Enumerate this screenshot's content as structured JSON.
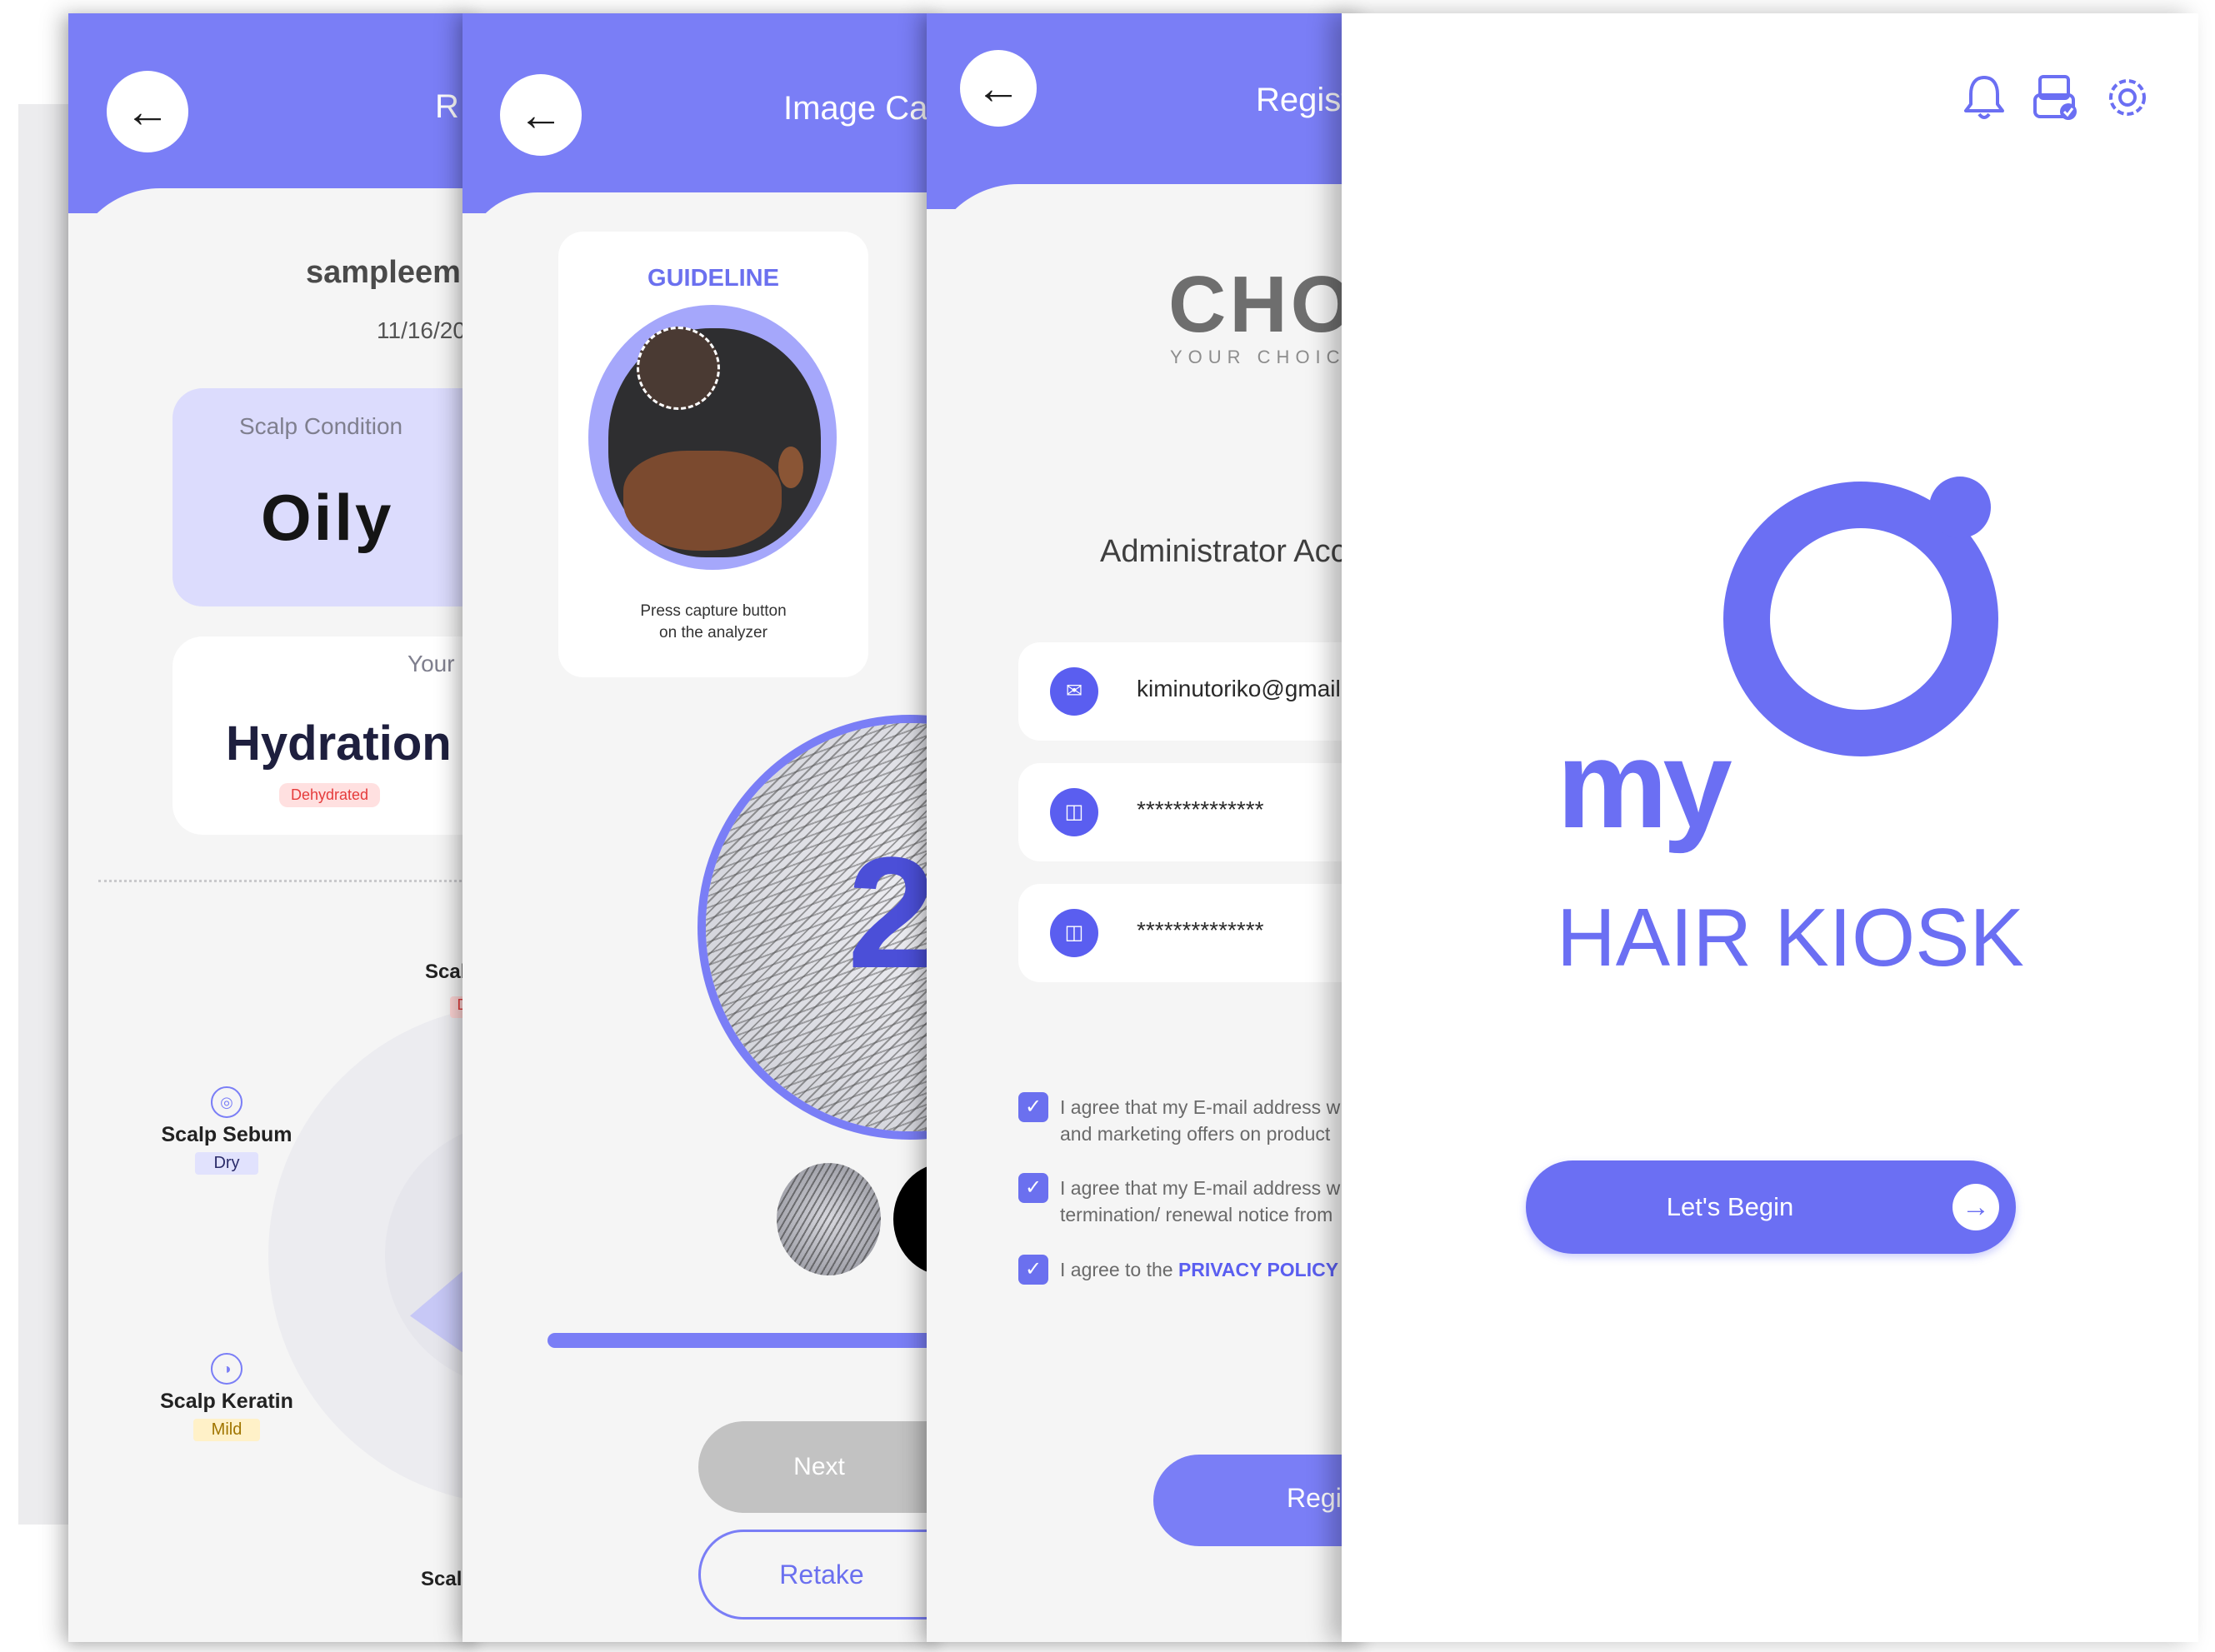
{
  "colors": {
    "accent": "#7a7ef6",
    "logo": "#6b6ff3",
    "danger": "#e53b3b"
  },
  "result_screen": {
    "header_title": "R",
    "user_name": "sampleem",
    "date": "11/16/20",
    "scalp_condition_label": "Scalp Condition",
    "scalp_condition_value": "Oily",
    "your_label": "Your",
    "hydration_title": "Hydration",
    "hydration_badge": "Dehydrated",
    "metrics": [
      {
        "name": "Scalp Sebum",
        "tag": "Dry",
        "icon": "sebum-icon"
      },
      {
        "name": "Scalp Keratin",
        "tag": "Mild",
        "icon": "keratin-icon"
      }
    ],
    "edge_label_top": "Scal",
    "edge_tag_top": "D",
    "edge_label_bottom": "Scal"
  },
  "capture_screen": {
    "header_title": "Image Cap",
    "guideline_title": "GUIDELINE",
    "guideline_text_line1": "Press capture button",
    "guideline_text_line2": "on the analyzer",
    "countdown": "2",
    "next_label": "Next",
    "retake_label": "Retake"
  },
  "register_screen": {
    "header_title": "Regist",
    "brand": "CHO",
    "brand_tagline": "YOUR CHOICE",
    "section_title": "Administrator Acc",
    "email_value": "kiminutoriko@gmail.c",
    "password_value": "**************",
    "confirm_value": "**************",
    "agree1_line1": "I agree that my E-mail address w",
    "agree1_line2": "and marketing offers on product",
    "agree2_line1": "I agree that my E-mail address w",
    "agree2_line2": "termination/ renewal notice from",
    "agree3_prefix": "I agree to the ",
    "agree3_link": "PRIVACY POLICY",
    "register_label": "Regi"
  },
  "home_screen": {
    "icons": [
      "bell-icon",
      "kiosk-device-icon",
      "gear-icon"
    ],
    "logo_my": "my",
    "logo_kiosk": "HAIR KIOSK",
    "begin_label": "Let's Begin"
  }
}
